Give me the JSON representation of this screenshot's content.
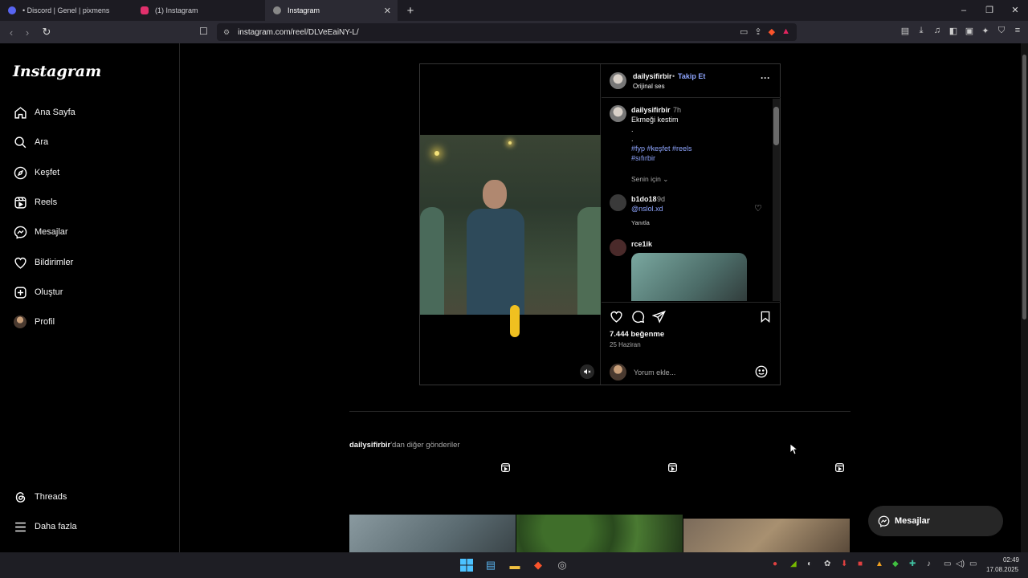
{
  "browser": {
    "tabs": [
      {
        "title": "• Discord | Genel | pixmens",
        "active": false,
        "favicon_color": "#5865f2"
      },
      {
        "title": "(1) Instagram",
        "active": false,
        "favicon_color": "#e1306c"
      },
      {
        "title": "Instagram",
        "active": true,
        "favicon_color": "#888888"
      }
    ],
    "url": "instagram.com/reel/DLVeEaiNY-L/"
  },
  "sidebar": {
    "logo": "Instagram",
    "items": [
      {
        "label": "Ana Sayfa",
        "icon": "home-icon"
      },
      {
        "label": "Ara",
        "icon": "search-icon"
      },
      {
        "label": "Keşfet",
        "icon": "compass-icon"
      },
      {
        "label": "Reels",
        "icon": "reels-icon"
      },
      {
        "label": "Mesajlar",
        "icon": "messenger-icon"
      },
      {
        "label": "Bildirimler",
        "icon": "heart-icon"
      },
      {
        "label": "Oluştur",
        "icon": "plus-square-icon"
      },
      {
        "label": "Profil",
        "icon": "avatar-icon"
      }
    ],
    "bottom": [
      {
        "label": "Threads",
        "icon": "threads-icon"
      },
      {
        "label": "Daha fazla",
        "icon": "menu-icon"
      }
    ]
  },
  "post": {
    "username": "dailysifirbir",
    "follow": "Takip Et",
    "audio": "Orijinal ses",
    "caption": {
      "username": "dailysifirbir",
      "time": "7h",
      "line1": "Ekmeği kestim",
      "dot1": ".",
      "dot2": ".",
      "tags1": "#fyp #keşfet #reels",
      "tags2": "#sıfırbir"
    },
    "sort": "Senin için",
    "comments": [
      {
        "username": "b1do18",
        "time": "9d",
        "text": "@nslol.xd",
        "reply": "Yanıtla"
      },
      {
        "username": "rce1ik"
      }
    ],
    "likes": "7.444 beğenme",
    "date": "25 Haziran",
    "comment_placeholder": "Yorum ekle..."
  },
  "more_posts": {
    "username": "dailysifirbir",
    "suffix": "'dan diğer gönderiler"
  },
  "messages_button": "Mesajlar",
  "clock": {
    "time": "02:49",
    "date": "17.08.2025"
  }
}
